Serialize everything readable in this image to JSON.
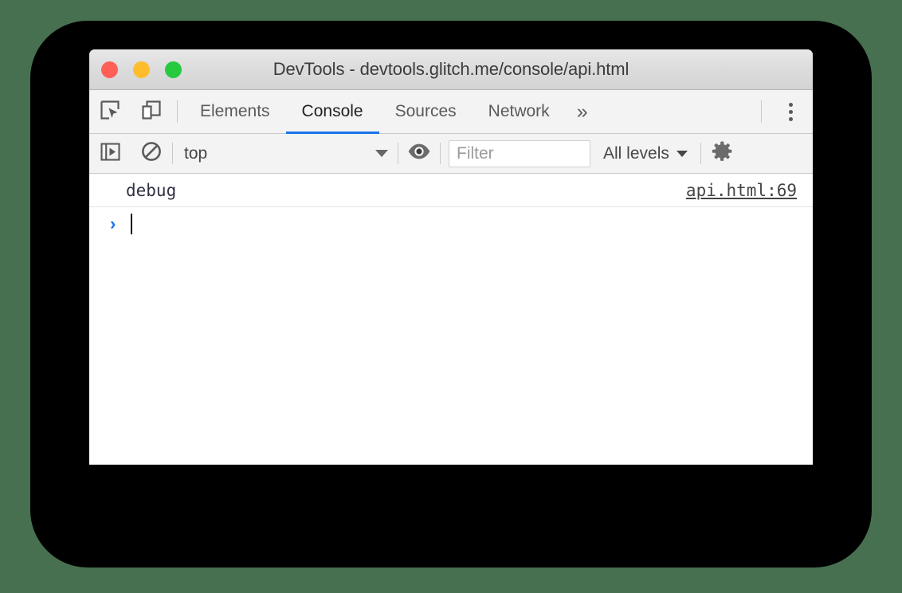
{
  "window": {
    "title": "DevTools - devtools.glitch.me/console/api.html",
    "traffic_lights": [
      {
        "name": "close",
        "color": "#FF5F56"
      },
      {
        "name": "minimize",
        "color": "#FFBD2E"
      },
      {
        "name": "zoom",
        "color": "#27C93F"
      }
    ]
  },
  "tabstrip": {
    "left_icons": [
      {
        "name": "inspect-element-icon",
        "label": "Inspect element"
      },
      {
        "name": "device-toolbar-icon",
        "label": "Toggle device toolbar"
      }
    ],
    "tabs": [
      {
        "label": "Elements",
        "active": false
      },
      {
        "label": "Console",
        "active": true
      },
      {
        "label": "Sources",
        "active": false
      },
      {
        "label": "Network",
        "active": false
      }
    ],
    "more_tabs_label": "»",
    "menu_label": "Customize and control DevTools"
  },
  "filterbar": {
    "sidebar_toggle_label": "Show console sidebar",
    "clear_console_label": "Clear console",
    "context": {
      "value": "top",
      "caret": "▼"
    },
    "eye_label": "Create live expression",
    "filter": {
      "value": "",
      "placeholder": "Filter"
    },
    "levels": {
      "value": "All levels",
      "caret": "▼"
    },
    "settings_label": "Console settings"
  },
  "console": {
    "messages": [
      {
        "text": "debug",
        "source": "api.html:69"
      }
    ],
    "prompt": {
      "chevron": "›",
      "value": ""
    }
  },
  "colors": {
    "accent": "#1a73e8",
    "toolbar_bg": "#f3f3f3",
    "titlebar_bg": "#dcdcdc",
    "backdrop": "#000000",
    "page_bg": "#477050",
    "message_text": "#303142",
    "link": "#454545"
  }
}
